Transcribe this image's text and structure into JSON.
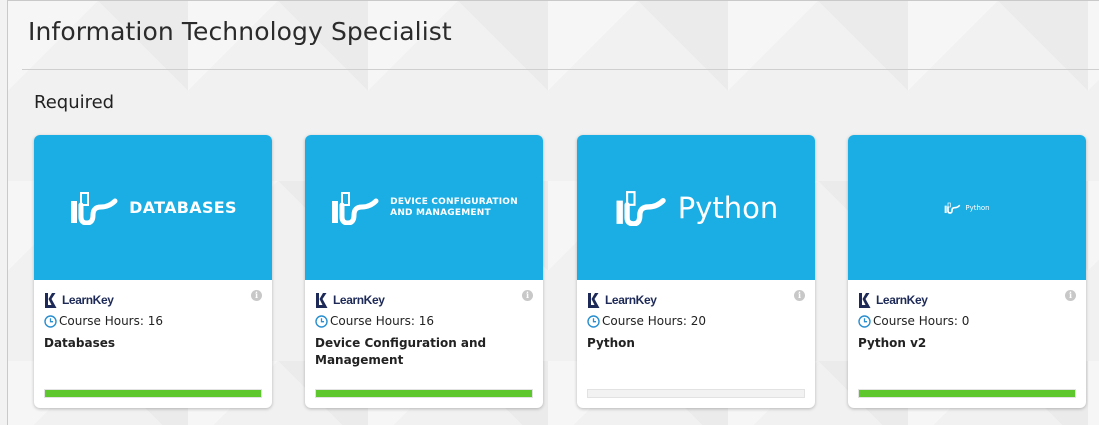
{
  "page": {
    "title": "Information Technology Specialist",
    "section": "Required"
  },
  "colors": {
    "banner": "#1aaee5",
    "progress": "#5ec72e",
    "brand": "#1d2a57",
    "clock": "#2a8fd0"
  },
  "courses": [
    {
      "banner_text": "DATABASES",
      "banner_line2": "",
      "brand": "LearnKey",
      "hours_label": "Course Hours: 16",
      "title": "Databases",
      "progress": 1.0
    },
    {
      "banner_text": "DEVICE CONFIGURATION",
      "banner_line2": "AND MANAGEMENT",
      "brand": "LearnKey",
      "hours_label": "Course Hours: 16",
      "title": "Device Configuration and Management",
      "progress": 1.0
    },
    {
      "banner_text": "Python",
      "banner_line2": "",
      "brand": "LearnKey",
      "hours_label": "Course Hours: 20",
      "title": "Python",
      "progress": 0.0
    },
    {
      "banner_text": "Python",
      "banner_line2": "",
      "brand": "LearnKey",
      "hours_label": "Course Hours: 0",
      "title": "Python v2",
      "progress": 1.0
    }
  ],
  "icons": [
    "it-logo-icon",
    "learnkey-logo-icon",
    "clock-icon",
    "info-icon"
  ]
}
